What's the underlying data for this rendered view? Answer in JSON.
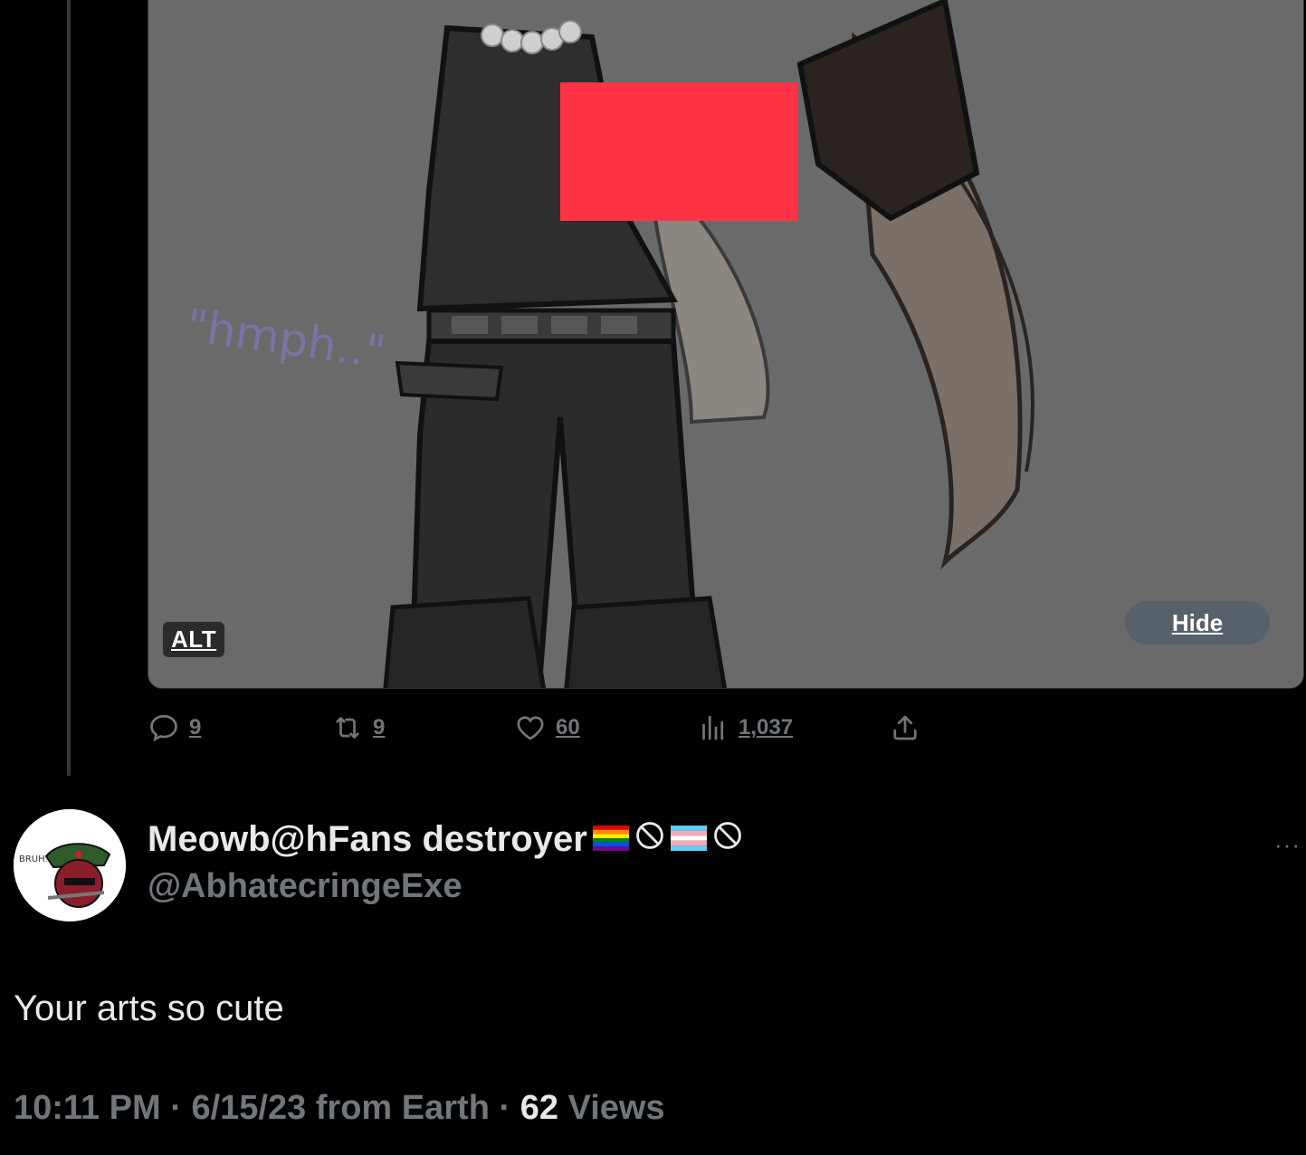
{
  "media": {
    "caption_text": "\"hmph..\"",
    "alt_label": "ALT",
    "hide_label": "Hide"
  },
  "actions": {
    "replies": "9",
    "reposts": "9",
    "likes": "60",
    "views": "1,037"
  },
  "reply": {
    "display_name": "Meowb@hFans destroyer",
    "handle": "@AbhatecringeExe",
    "avatar_text": "BRUH...",
    "more_label": "···",
    "text": "Your arts so cute",
    "time": "10:11 PM",
    "separator": "·",
    "date_source": "6/15/23 from Earth",
    "views_count": "62",
    "views_label": "Views"
  },
  "colors": {
    "background": "#000000",
    "text_primary": "#e7e9ea",
    "text_secondary": "#71767b",
    "censor_red": "#ff3344",
    "media_bg": "#6b6b6b"
  },
  "icons": [
    "reply-icon",
    "repost-icon",
    "like-icon",
    "views-icon",
    "share-icon",
    "pride-flag-icon",
    "prohibited-icon",
    "trans-flag-icon"
  ]
}
